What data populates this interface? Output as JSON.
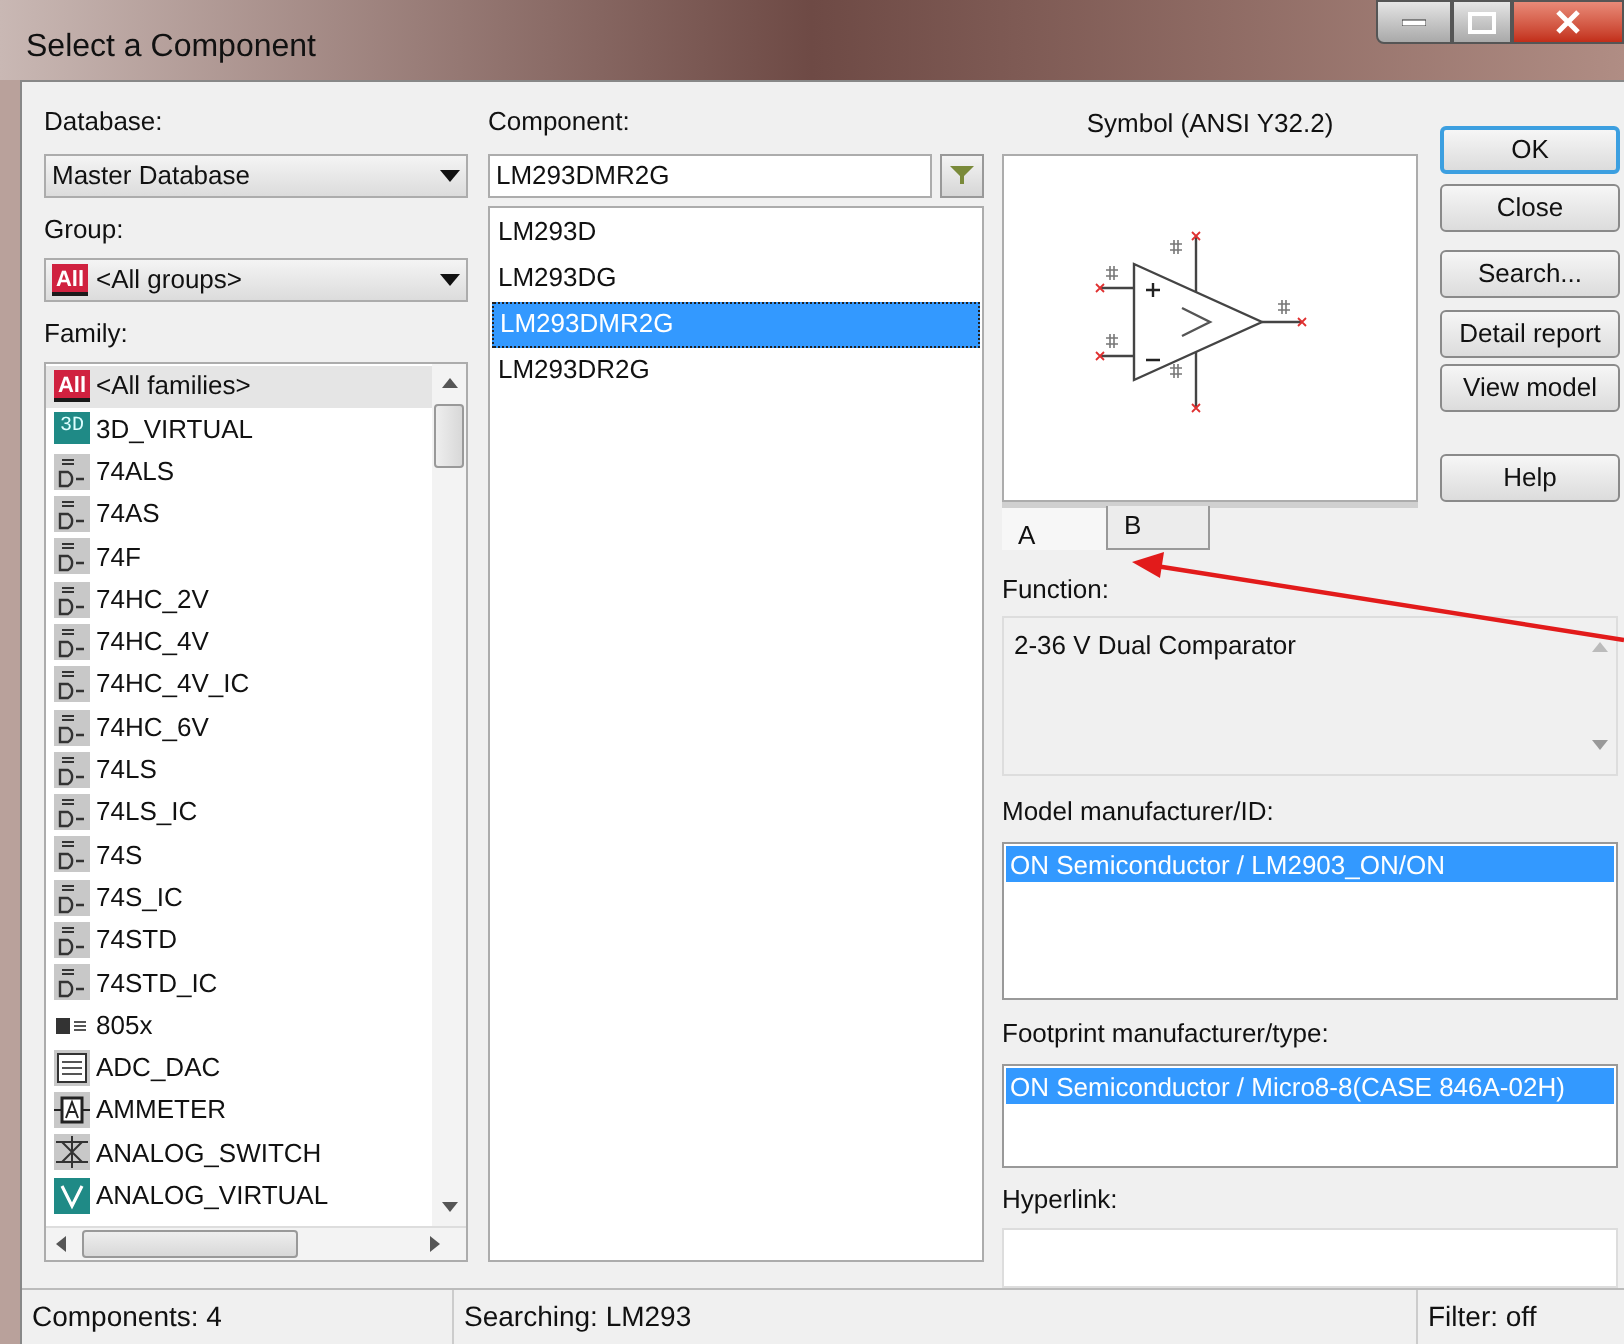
{
  "window": {
    "title": "Select a Component"
  },
  "database": {
    "label": "Database:",
    "value": "Master Database"
  },
  "group": {
    "label": "Group:",
    "badge": "All",
    "value": "<All groups>"
  },
  "family": {
    "label": "Family:",
    "items": [
      {
        "name": "<All families>",
        "kind": "all",
        "badge": "All",
        "selected": true
      },
      {
        "name": "3D_VIRTUAL",
        "kind": "teal",
        "badge": "3D",
        "selected": false
      },
      {
        "name": "74ALS",
        "kind": "gate",
        "selected": false
      },
      {
        "name": "74AS",
        "kind": "gate",
        "selected": false
      },
      {
        "name": "74F",
        "kind": "gate",
        "selected": false
      },
      {
        "name": "74HC_2V",
        "kind": "gate",
        "selected": false
      },
      {
        "name": "74HC_4V",
        "kind": "gate",
        "selected": false
      },
      {
        "name": "74HC_4V_IC",
        "kind": "gate",
        "selected": false
      },
      {
        "name": "74HC_6V",
        "kind": "gate",
        "selected": false
      },
      {
        "name": "74LS",
        "kind": "gate",
        "selected": false
      },
      {
        "name": "74LS_IC",
        "kind": "gate",
        "selected": false
      },
      {
        "name": "74S",
        "kind": "gate",
        "selected": false
      },
      {
        "name": "74S_IC",
        "kind": "gate",
        "selected": false
      },
      {
        "name": "74STD",
        "kind": "gate",
        "selected": false
      },
      {
        "name": "74STD_IC",
        "kind": "gate",
        "selected": false
      },
      {
        "name": "805x",
        "kind": "chip",
        "selected": false
      },
      {
        "name": "ADC_DAC",
        "kind": "converter",
        "selected": false
      },
      {
        "name": "AMMETER",
        "kind": "meter",
        "selected": false
      },
      {
        "name": "ANALOG_SWITCH",
        "kind": "switch",
        "selected": false
      },
      {
        "name": "ANALOG_VIRTUAL",
        "kind": "virtual",
        "selected": false
      }
    ]
  },
  "component": {
    "label": "Component:",
    "value": "LM293DMR2G",
    "items": [
      {
        "name": "LM293D",
        "selected": false
      },
      {
        "name": "LM293DG",
        "selected": false
      },
      {
        "name": "LM293DMR2G",
        "selected": true
      },
      {
        "name": "LM293DR2G",
        "selected": false
      }
    ]
  },
  "symbol": {
    "title": "Symbol (ANSI Y32.2)",
    "tabs": [
      {
        "label": "A",
        "selected": true
      },
      {
        "label": "B",
        "selected": false
      }
    ]
  },
  "function": {
    "label": "Function:",
    "value": "2-36 V Dual Comparator"
  },
  "model": {
    "label": "Model manufacturer/ID:",
    "items": [
      {
        "text": "ON Semiconductor / LM2903_ON/ON",
        "selected": true
      }
    ]
  },
  "footprint": {
    "label": "Footprint manufacturer/type:",
    "items": [
      {
        "text": "ON Semiconductor / Micro8-8(CASE 846A-02H)",
        "selected": true
      }
    ]
  },
  "hyperlink": {
    "label": "Hyperlink:"
  },
  "buttons": [
    {
      "label": "OK",
      "default": true
    },
    {
      "label": "Close",
      "default": false
    },
    {
      "label": "Search...",
      "default": false
    },
    {
      "label": "Detail report",
      "default": false
    },
    {
      "label": "View model",
      "default": false
    },
    {
      "label": "Help",
      "default": false
    }
  ],
  "status_bar": [
    "Components: 4",
    "Searching: LM293",
    "Filter: off"
  ]
}
